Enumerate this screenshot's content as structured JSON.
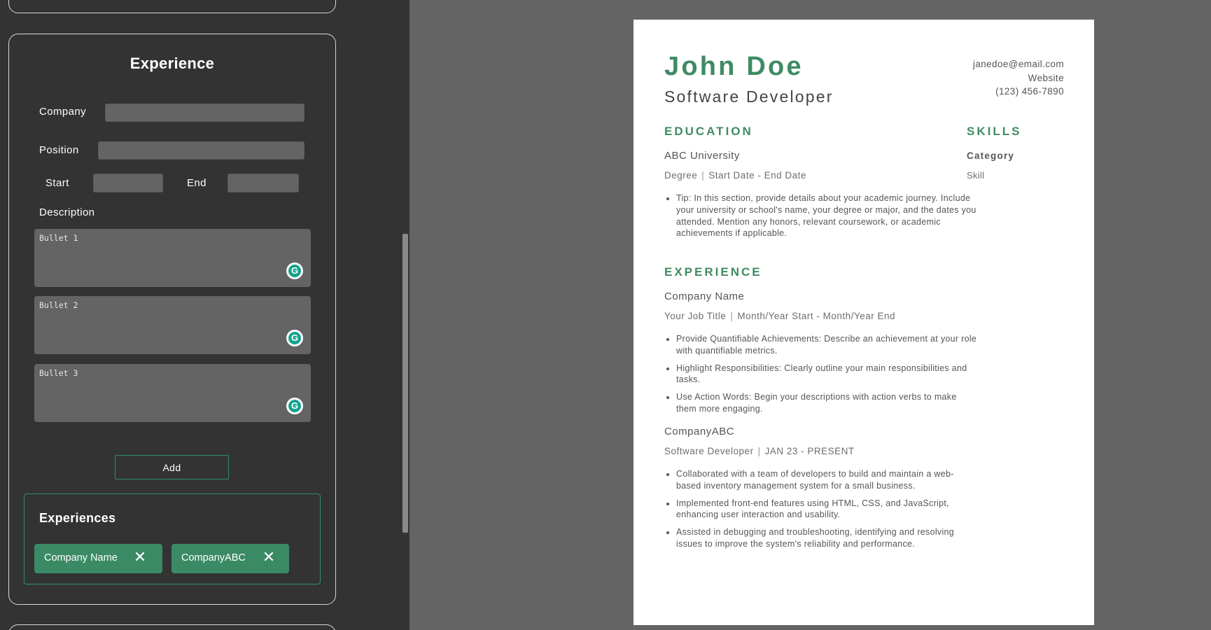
{
  "editor": {
    "section_title": "Experience",
    "labels": {
      "company": "Company",
      "position": "Position",
      "start": "Start",
      "end": "End",
      "description": "Description"
    },
    "inputs": {
      "company": "",
      "position": "",
      "start": "",
      "end": ""
    },
    "bullets": [
      {
        "placeholder": "Bullet 1",
        "value": ""
      },
      {
        "placeholder": "Bullet 2",
        "value": ""
      },
      {
        "placeholder": "Bullet 3",
        "value": ""
      }
    ],
    "add_button": "Add",
    "experiences_title": "Experiences",
    "experiences": [
      {
        "label": "Company Name",
        "remove_icon": "✕"
      },
      {
        "label": "CompanyABC",
        "remove_icon": "✕"
      }
    ],
    "grammarly_icon": "G",
    "accent_color": "#3a8a66"
  },
  "resume": {
    "name": "John Doe",
    "title": "Software Developer",
    "contact": {
      "email": "janedoe@email.com",
      "website": "Website",
      "phone": "(123) 456-7890"
    },
    "education": {
      "heading": "EDUCATION",
      "school": "ABC University",
      "degree": "Degree",
      "start": "Start Date",
      "dash": "-",
      "end": "End Date",
      "bullets": [
        "Tip: In this section, provide details about your academic journey. Include your university or school's name, your degree or major, and the dates you attended. Mention any honors, relevant coursework, or academic achievements if applicable."
      ]
    },
    "experience": {
      "heading": "EXPERIENCE",
      "jobs": [
        {
          "company": "Company Name",
          "role": "Your Job Title",
          "start": "Month/Year Start",
          "dash": "-",
          "end": "Month/Year End",
          "bullets": [
            "Provide Quantifiable Achievements: Describe an achievement at your role with quantifiable metrics.",
            "Highlight Responsibilities: Clearly outline your main responsibilities and tasks.",
            "Use Action Words: Begin your descriptions with action verbs to make them more engaging."
          ]
        },
        {
          "company": "CompanyABC",
          "role": "Software Developer",
          "start": "JAN 23",
          "dash": "-",
          "end": "PRESENT",
          "bullets": [
            "Collaborated with a team of developers to build and maintain a web-based inventory management system for a small business.",
            "Implemented front-end features using HTML, CSS, and JavaScript, enhancing user interaction and usability.",
            "Assisted in debugging and troubleshooting, identifying and resolving issues to improve the system's reliability and performance."
          ]
        }
      ]
    },
    "skills": {
      "heading": "SKILLS",
      "category": "Category",
      "skill": "Skill"
    },
    "accent_color": "#3f8b63"
  }
}
